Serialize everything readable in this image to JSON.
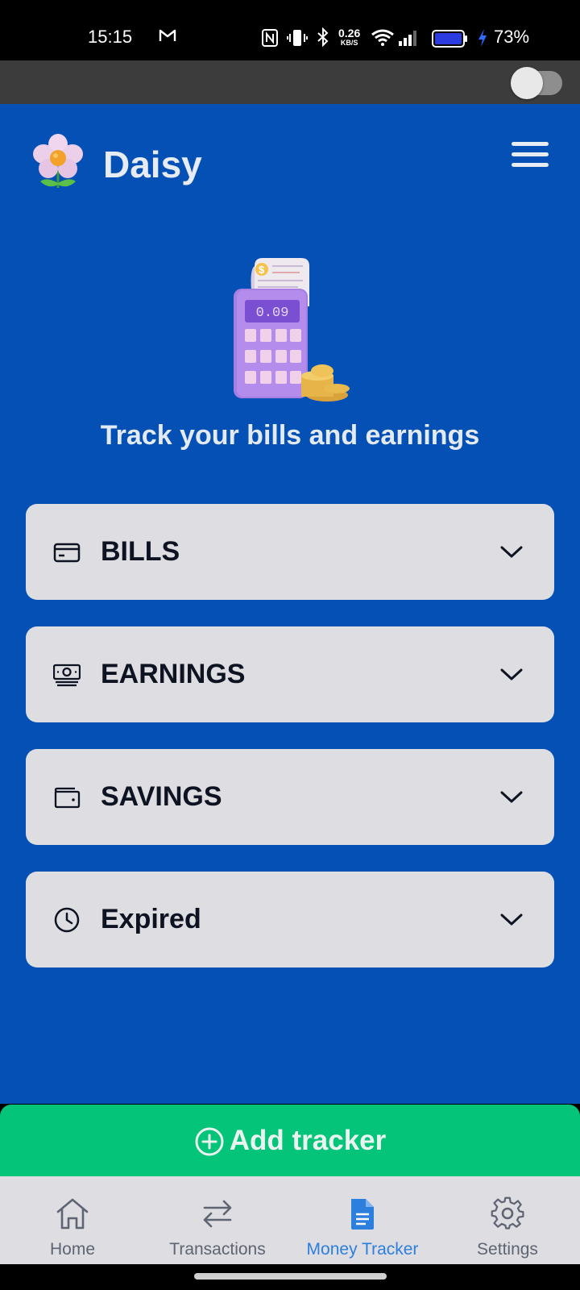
{
  "status_bar": {
    "time": "15:15",
    "speed_value": "0.26",
    "speed_unit": "KB/S",
    "battery": "73%"
  },
  "header": {
    "brand": "Daisy"
  },
  "hero": {
    "calculator_display": "0.09",
    "tagline": "Track your bills and earnings"
  },
  "sections": [
    {
      "label": "BILLS",
      "icon": "credit-card-icon"
    },
    {
      "label": "EARNINGS",
      "icon": "banknotes-icon"
    },
    {
      "label": "SAVINGS",
      "icon": "wallet-icon"
    },
    {
      "label": "Expired",
      "icon": "clock-icon"
    }
  ],
  "add_button": {
    "label": "Add tracker",
    "icon": "plus-circle-icon"
  },
  "bottom_nav": [
    {
      "label": "Home",
      "icon": "home-icon"
    },
    {
      "label": "Transactions",
      "icon": "arrows-swap-icon"
    },
    {
      "label": "Money Tracker",
      "icon": "document-icon",
      "active": true
    },
    {
      "label": "Settings",
      "icon": "gear-icon"
    }
  ],
  "colors": {
    "primary_blue": "#0450b4",
    "card_bg": "#dddde2",
    "accent_green": "#04c47a",
    "active_nav": "#2c7fdc"
  }
}
